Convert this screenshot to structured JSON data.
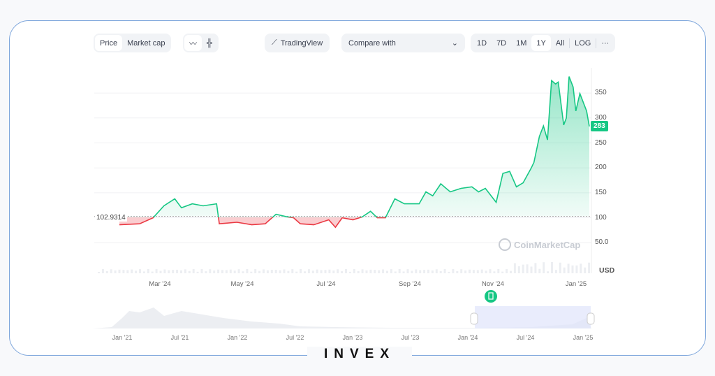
{
  "toolbar": {
    "price": "Price",
    "market_cap": "Market cap",
    "line_icon": "line-chart-icon",
    "candle_icon": "candlestick-icon",
    "tradingview": "TradingView",
    "compare": "Compare with",
    "ranges": [
      "1D",
      "7D",
      "1M",
      "1Y",
      "All"
    ],
    "active_range": "1Y",
    "log": "LOG",
    "more": "···"
  },
  "chart_data": {
    "type": "area",
    "y_ticks": [
      "350",
      "300",
      "250",
      "200",
      "150",
      "100",
      "50.0"
    ],
    "y_unit": "USD",
    "x_ticks": [
      "Mar '24",
      "May '24",
      "Jul '24",
      "Sep '24",
      "Nov '24",
      "Jan '25"
    ],
    "baseline": 102.9314,
    "baseline_label": "102.9314",
    "current_price": "283",
    "colors": {
      "up": "#16c784",
      "down": "#ea3943"
    },
    "ylim": [
      0,
      390
    ],
    "series": [
      [
        "2024-01-31",
        86
      ],
      [
        "2024-02-15",
        88
      ],
      [
        "2024-02-25",
        100
      ],
      [
        "2024-03-04",
        124
      ],
      [
        "2024-03-12",
        138
      ],
      [
        "2024-03-17",
        120
      ],
      [
        "2024-03-25",
        128
      ],
      [
        "2024-04-02",
        124
      ],
      [
        "2024-04-12",
        128
      ],
      [
        "2024-04-14",
        88
      ],
      [
        "2024-04-27",
        91
      ],
      [
        "2024-05-08",
        86
      ],
      [
        "2024-05-18",
        88
      ],
      [
        "2024-05-26",
        107
      ],
      [
        "2024-06-03",
        102
      ],
      [
        "2024-06-08",
        100
      ],
      [
        "2024-06-13",
        88
      ],
      [
        "2024-06-23",
        86
      ],
      [
        "2024-07-04",
        96
      ],
      [
        "2024-07-09",
        81
      ],
      [
        "2024-07-14",
        100
      ],
      [
        "2024-07-22",
        96
      ],
      [
        "2024-07-29",
        102
      ],
      [
        "2024-08-04",
        113
      ],
      [
        "2024-08-09",
        100
      ],
      [
        "2024-08-15",
        100
      ],
      [
        "2024-08-22",
        138
      ],
      [
        "2024-08-29",
        128
      ],
      [
        "2024-09-09",
        128
      ],
      [
        "2024-09-14",
        152
      ],
      [
        "2024-09-19",
        144
      ],
      [
        "2024-09-25",
        168
      ],
      [
        "2024-10-02",
        152
      ],
      [
        "2024-10-10",
        159
      ],
      [
        "2024-10-18",
        162
      ],
      [
        "2024-10-23",
        152
      ],
      [
        "2024-10-28",
        159
      ],
      [
        "2024-11-05",
        131
      ],
      [
        "2024-11-10",
        189
      ],
      [
        "2024-11-15",
        193
      ],
      [
        "2024-11-20",
        162
      ],
      [
        "2024-11-25",
        170
      ],
      [
        "2024-12-01",
        200
      ],
      [
        "2024-12-03",
        211
      ],
      [
        "2024-12-07",
        263
      ],
      [
        "2024-12-10",
        284
      ],
      [
        "2024-12-13",
        256
      ],
      [
        "2024-12-16",
        375
      ],
      [
        "2024-12-19",
        368
      ],
      [
        "2024-12-21",
        372
      ],
      [
        "2024-12-25",
        286
      ],
      [
        "2024-12-27",
        300
      ],
      [
        "2024-12-29",
        383
      ],
      [
        "2025-01-01",
        362
      ],
      [
        "2025-01-03",
        314
      ],
      [
        "2025-01-06",
        349
      ],
      [
        "2025-01-11",
        314
      ],
      [
        "2025-01-13",
        283
      ]
    ]
  },
  "navigator": {
    "x_ticks": [
      "Jan '21",
      "Jul '21",
      "Jan '22",
      "Jul '22",
      "Jan '23",
      "Jul '23",
      "Jan '24",
      "Jul '24",
      "Jan '25"
    ]
  },
  "watermark": "CoinMarketCap",
  "logo": "INVEX"
}
